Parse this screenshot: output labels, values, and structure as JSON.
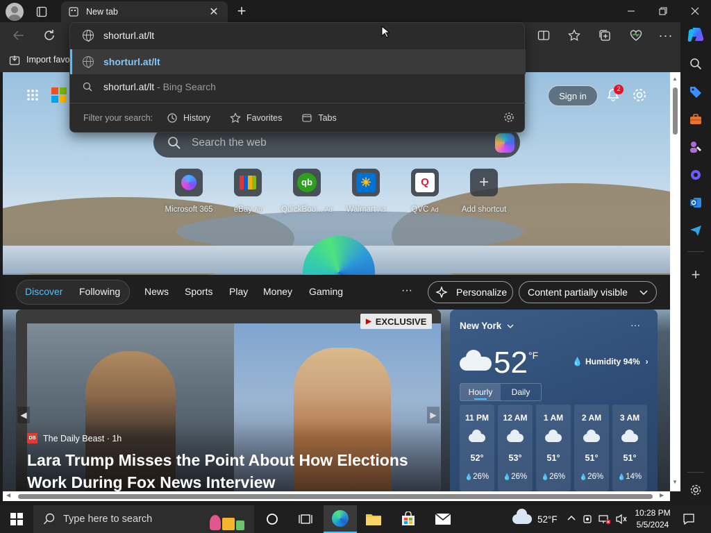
{
  "browser": {
    "tab_title": "New tab",
    "address_text": "shorturl.at/lt",
    "favorites_bar_text": "Import favo"
  },
  "omnibox": {
    "input_value": "shorturl.at/lt",
    "suggestion_url": "shorturl.at/lt",
    "search_query": "shorturl.at/lt",
    "search_suffix": " - Bing Search",
    "filter_label": "Filter your search:",
    "filters": [
      "History",
      "Favorites",
      "Tabs"
    ]
  },
  "newtab": {
    "search_placeholder": "Search the web",
    "sign_in": "Sign in",
    "notification_count": "2",
    "quick_links": [
      {
        "label": "Microsoft 365",
        "ad": ""
      },
      {
        "label": "eBay",
        "ad": "Ad"
      },
      {
        "label": "QuickBoo...",
        "ad": "Ad"
      },
      {
        "label": "Walmart",
        "ad": "Ad"
      },
      {
        "label": "QVC",
        "ad": "Ad"
      },
      {
        "label": "Add shortcut",
        "ad": ""
      }
    ]
  },
  "feed": {
    "tabs": [
      "Discover",
      "Following"
    ],
    "nav": [
      "News",
      "Sports",
      "Play",
      "Money",
      "Gaming"
    ],
    "more": "···",
    "personalize": "Personalize",
    "content_visibility": "Content partially visible"
  },
  "news_card": {
    "badge": "EXCLUSIVE",
    "source": "The Daily Beast · 1h",
    "headline_line1": "Lara Trump Misses the Point About How Elections",
    "headline_line2": "Work During Fox News Interview"
  },
  "weather": {
    "city": "New York",
    "temp": "52",
    "unit": "°F",
    "humidity": "Humidity 94%",
    "tabs": [
      "Hourly",
      "Daily"
    ],
    "hourly": [
      {
        "time": "11 PM",
        "temp": "52°",
        "precip": "26%"
      },
      {
        "time": "12 AM",
        "temp": "53°",
        "precip": "26%"
      },
      {
        "time": "1 AM",
        "temp": "51°",
        "precip": "26%"
      },
      {
        "time": "2 AM",
        "temp": "51°",
        "precip": "26%"
      },
      {
        "time": "3 AM",
        "temp": "51°",
        "precip": "14%"
      }
    ]
  },
  "taskbar": {
    "search_placeholder": "Type here to search",
    "weather_temp": "52°F",
    "time": "10:28 PM",
    "date": "5/5/2024"
  },
  "colors": {
    "accent": "#4cc2ff",
    "notification_badge": "#e81123",
    "active_tab_underline": "#4cc2ff"
  }
}
